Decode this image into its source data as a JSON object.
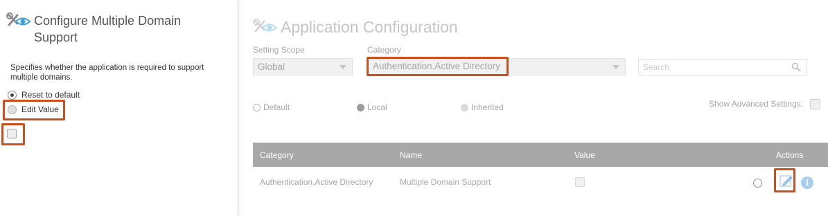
{
  "left_panel": {
    "title": "Configure Multiple Domain Support",
    "description": "Specifies whether the application is required to support multiple domains.",
    "options": {
      "reset_label": "Reset to default",
      "edit_label": "Edit Value"
    },
    "value_checked": false
  },
  "main": {
    "title": "Application Configuration",
    "setting_scope": {
      "label": "Setting Scope",
      "value": "Global"
    },
    "category": {
      "label": "Category",
      "value": "Authentication.Active Directory"
    },
    "search": {
      "placeholder": "Search"
    },
    "filters": {
      "default": "Default",
      "local": "Local",
      "inherited": "Inherited"
    },
    "show_advanced": {
      "label": "Show Advanced Settings:"
    },
    "table": {
      "headers": [
        "Category",
        "Name",
        "Value",
        "Actions"
      ],
      "rows": [
        {
          "category": "Authentication.Active Directory",
          "name": "Multiple Domain Support"
        }
      ]
    }
  },
  "colors": {
    "highlight": "#c9501c",
    "table_header": "#a8a8a8",
    "icon_blue": "#3a9fd8"
  },
  "icons": {
    "config": "wrench-screwdriver-eye-icon",
    "search": "search-icon",
    "edit": "edit-icon",
    "info": "info-icon"
  }
}
